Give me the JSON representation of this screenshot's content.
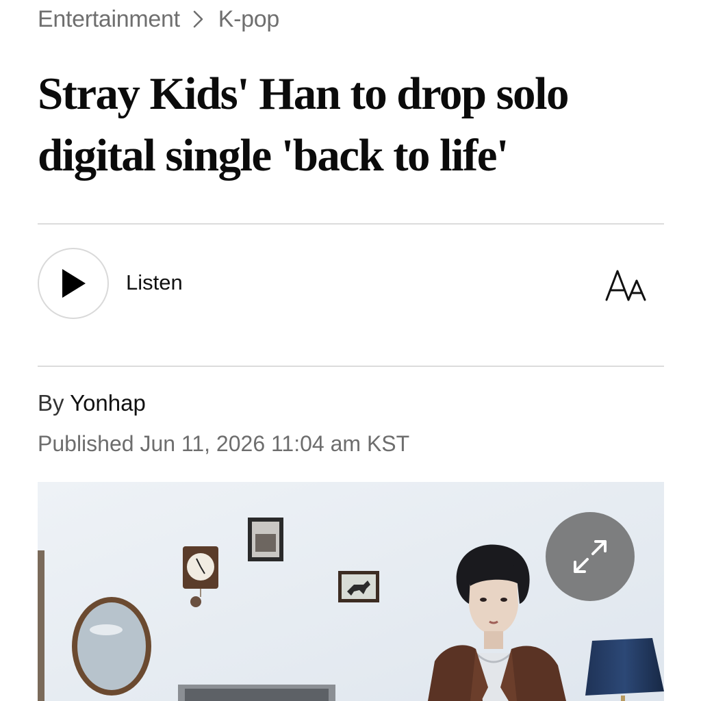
{
  "breadcrumb": {
    "section": "Entertainment",
    "subsection": "K-pop"
  },
  "article": {
    "headline_line1": "Stray Kids' Han to drop solo",
    "headline_line2": "digital single 'back to life'"
  },
  "audio": {
    "listen_label": "Listen"
  },
  "toolbar": {
    "font_size_icon": "text-size-icon",
    "font_size_glyph_large": "A",
    "font_size_glyph_small": "A"
  },
  "byline": {
    "prefix": "By",
    "author": "Yonhap"
  },
  "published": {
    "text": "Published Jun 11, 2026 11:04 am KST"
  },
  "image": {
    "expand_icon": "expand-icon"
  },
  "colors": {
    "text_primary": "#111111",
    "text_secondary": "#6f6f6f",
    "divider": "#dcdcdc",
    "expand_button_bg": "#6e6e6e"
  }
}
